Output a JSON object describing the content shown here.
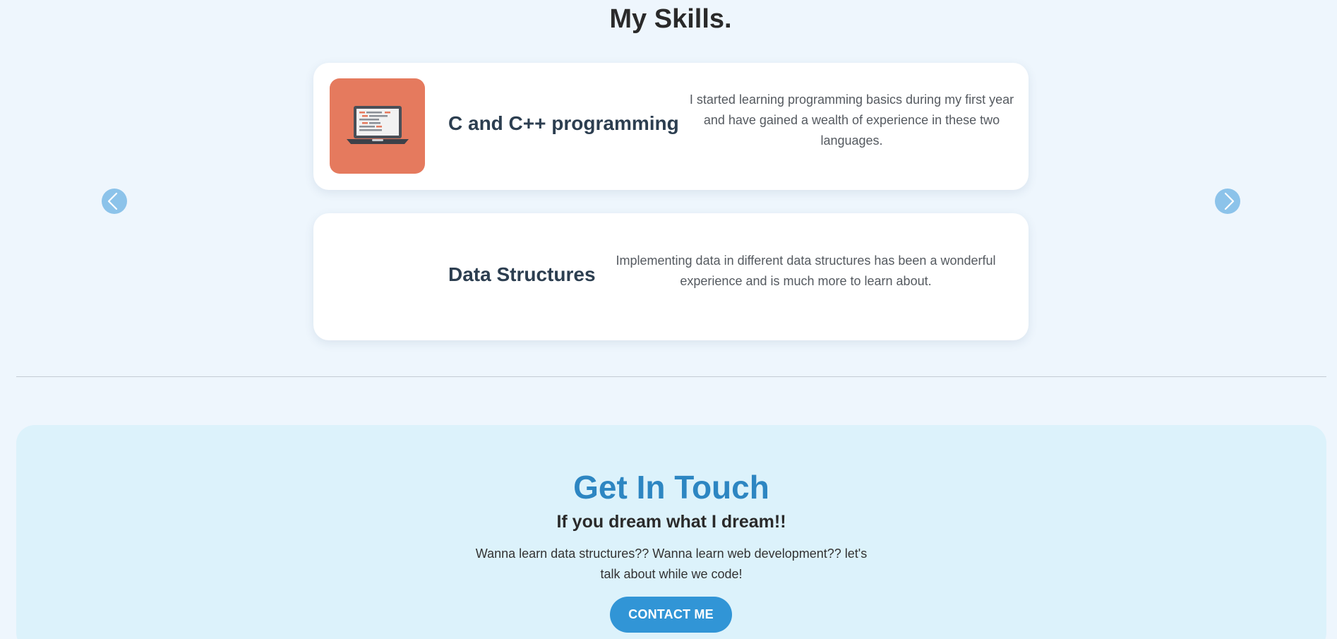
{
  "skills": {
    "title": "My Skills.",
    "items": [
      {
        "name": "C and C++ programming",
        "description": "I started learning programming basics during my first year and have gained a wealth of experience in these two languages.",
        "icon": "laptop-code-icon"
      },
      {
        "name": "Data Structures",
        "description": "Implementing data in different data structures has been a wonderful experience and is much more to learn about."
      }
    ],
    "prev_icon": "chevron-left-icon",
    "next_icon": "chevron-right-icon"
  },
  "contact": {
    "title": "Get In Touch",
    "subtitle": "If you dream what I dream!!",
    "text": "Wanna learn data structures?? Wanna learn web development?? let's talk about while we code!",
    "button_label": "CONTACT ME"
  },
  "colors": {
    "page_background": "#eef6fd",
    "card_background": "#ffffff",
    "icon_tile": "#e57a5e",
    "arrow": "#8cc3ea",
    "contact_background": "#dcf2fb",
    "contact_title": "#2d86c2",
    "button": "#3195d6"
  }
}
